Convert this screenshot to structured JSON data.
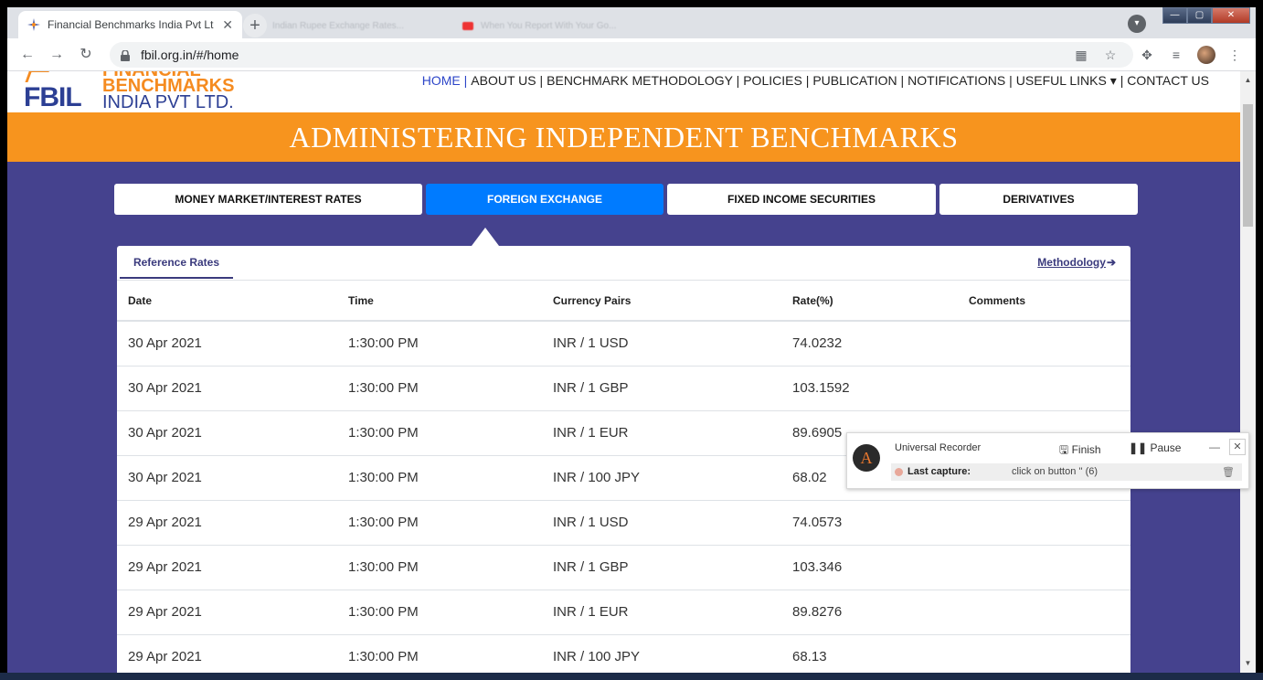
{
  "browser": {
    "tab_title": "Financial Benchmarks India Pvt Lt",
    "bg_tab_1": "Indian Rupee Exchange Rates...",
    "bg_tab_2": "When You Report With Your Go...",
    "url": "fbil.org.in/#/home",
    "window_controls": {
      "minimize": "—",
      "restore": "▢",
      "close": "✕"
    }
  },
  "site": {
    "logo": {
      "abbr": "FBIL",
      "line1": "FINANCIAL",
      "line2": "BENCHMARKS",
      "line3": "INDIA PVT LTD."
    },
    "nav": [
      {
        "label": "HOME |",
        "active": true
      },
      {
        "label": "ABOUT US |",
        "active": false
      },
      {
        "label": "BENCHMARK METHODOLOGY |",
        "active": false
      },
      {
        "label": "POLICIES |",
        "active": false
      },
      {
        "label": "PUBLICATION |",
        "active": false
      },
      {
        "label": "NOTIFICATIONS |",
        "active": false
      },
      {
        "label": "USEFUL LINKS ▾",
        "active": false
      },
      {
        "label": "| CONTACT US",
        "active": false
      }
    ],
    "banner": "ADMINISTERING INDEPENDENT BENCHMARKS",
    "categories": [
      {
        "label": "MONEY MARKET/INTEREST RATES",
        "active": false
      },
      {
        "label": "FOREIGN EXCHANGE",
        "active": true
      },
      {
        "label": "FIXED INCOME SECURITIES",
        "active": false
      },
      {
        "label": "DERIVATIVES",
        "active": false
      }
    ],
    "subtab": "Reference Rates",
    "methodology_link": "Methodology",
    "methodology_arrow": "➔",
    "table": {
      "headers": [
        "Date",
        "Time",
        "Currency Pairs",
        "Rate(%)",
        "Comments"
      ],
      "rows": [
        [
          "30 Apr 2021",
          "1:30:00 PM",
          "INR / 1 USD",
          "74.0232",
          ""
        ],
        [
          "30 Apr 2021",
          "1:30:00 PM",
          "INR / 1 GBP",
          "103.1592",
          ""
        ],
        [
          "30 Apr 2021",
          "1:30:00 PM",
          "INR / 1 EUR",
          "89.6905",
          ""
        ],
        [
          "30 Apr 2021",
          "1:30:00 PM",
          "INR / 100 JPY",
          "68.02",
          ""
        ],
        [
          "29 Apr 2021",
          "1:30:00 PM",
          "INR / 1 USD",
          "74.0573",
          ""
        ],
        [
          "29 Apr 2021",
          "1:30:00 PM",
          "INR / 1 GBP",
          "103.346",
          ""
        ],
        [
          "29 Apr 2021",
          "1:30:00 PM",
          "INR / 1 EUR",
          "89.8276",
          ""
        ],
        [
          "29 Apr 2021",
          "1:30:00 PM",
          "INR / 100 JPY",
          "68.13",
          ""
        ]
      ]
    }
  },
  "recorder": {
    "title": "Universal Recorder",
    "finish_label": "Finish",
    "pause_label": "Pause",
    "last_capture_label": "Last capture:",
    "last_capture_value": "click on button '' (6)"
  },
  "colors": {
    "page_bg": "#45428e",
    "banner_bg": "#f7941e",
    "active_tab": "#007bff",
    "logo_blue": "#2c3f94",
    "logo_orange": "#f58b20"
  }
}
